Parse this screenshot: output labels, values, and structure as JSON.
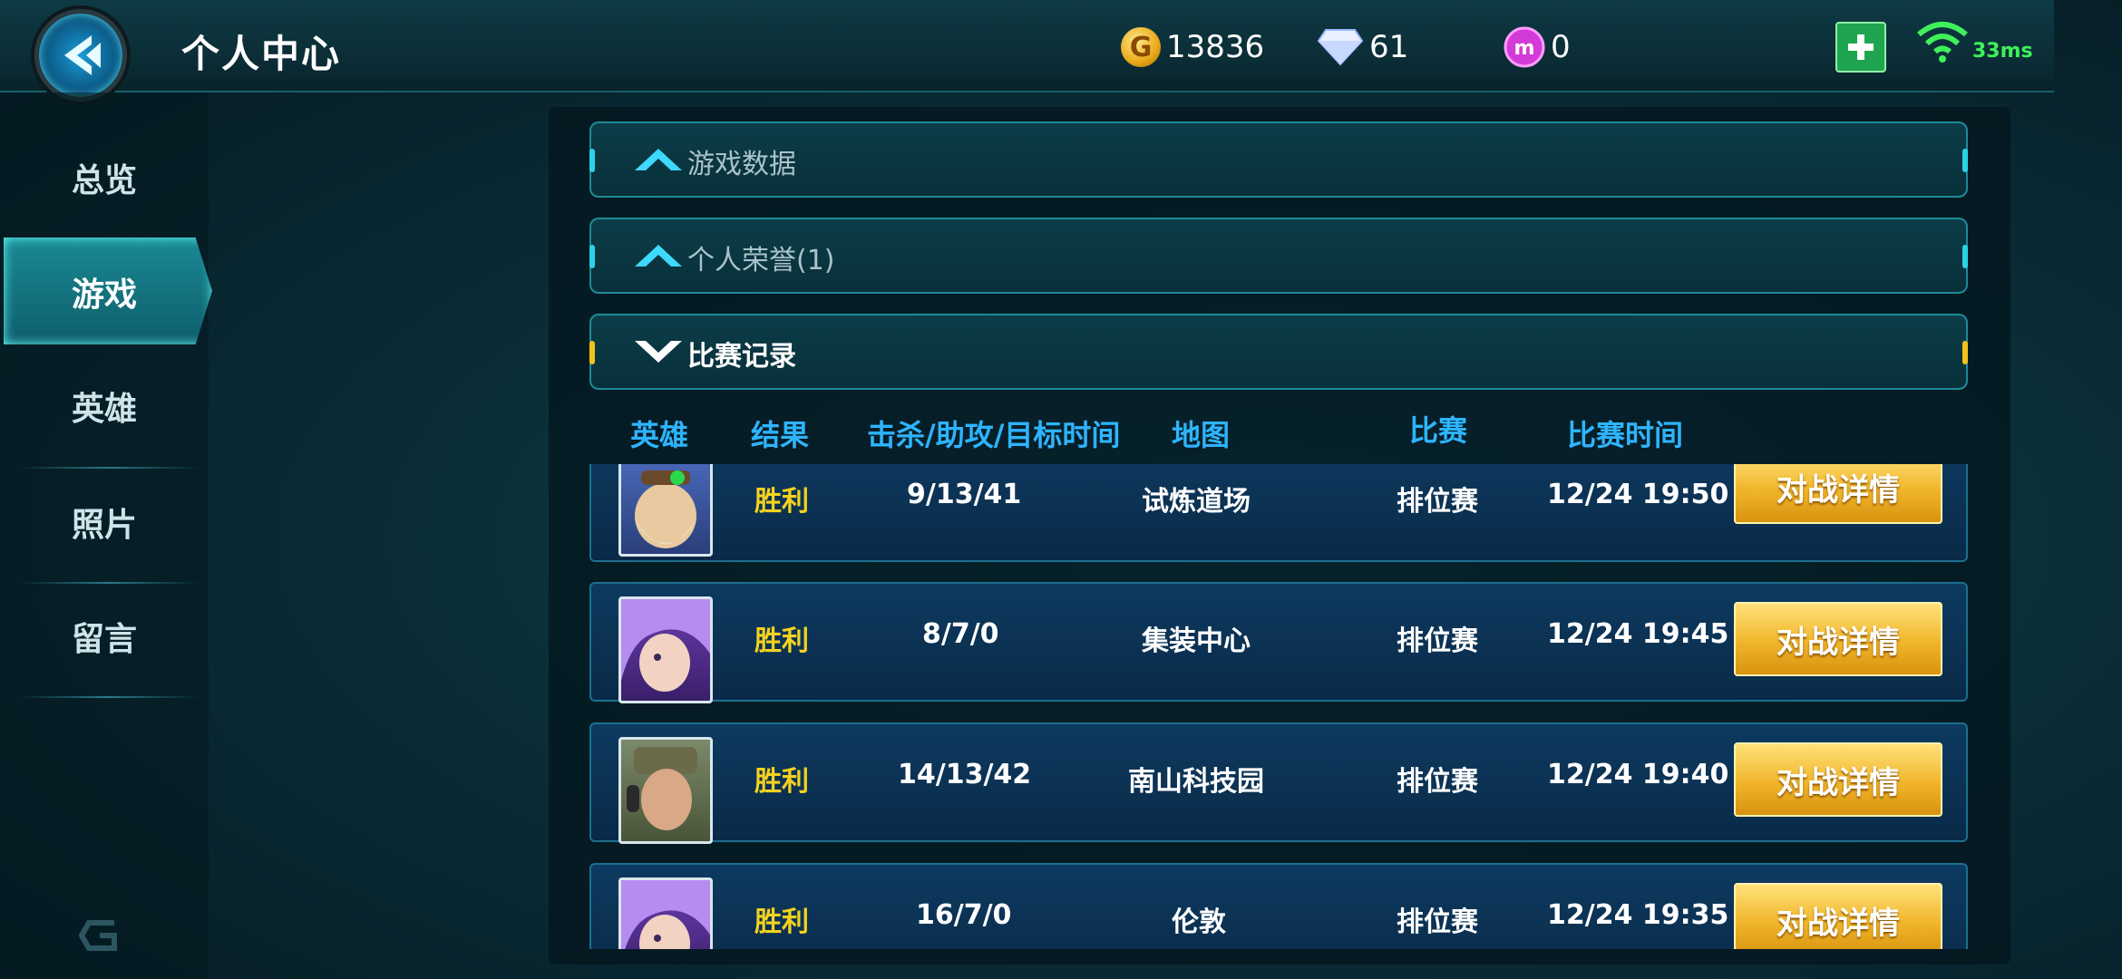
{
  "header": {
    "title": "个人中心",
    "gold": "13836",
    "diamond": "61",
    "gem": "0",
    "coin_glyph": "G",
    "ping": "33ms"
  },
  "sidebar": {
    "items": [
      {
        "label": "总览"
      },
      {
        "label": "游戏",
        "active": true
      },
      {
        "label": "英雄"
      },
      {
        "label": "照片"
      },
      {
        "label": "留言"
      }
    ]
  },
  "sections": [
    {
      "label": "游戏数据",
      "state": "collapsed-up"
    },
    {
      "label": "个人荣誉(1)",
      "state": "collapsed-up"
    },
    {
      "label": "比赛记录",
      "state": "expanded"
    }
  ],
  "table": {
    "columns": [
      "英雄",
      "结果",
      "击杀/助攻/目标时间",
      "地图",
      "比赛",
      "比赛时间"
    ],
    "detail_button": "对战详情",
    "rows": [
      {
        "hero": "hero-avatar-engineer",
        "result": "胜利",
        "kda": "9/13/41",
        "map": "试炼道场",
        "mode": "排位赛",
        "time": "12/24 19:50"
      },
      {
        "hero": "hero-avatar-purple-hair",
        "result": "胜利",
        "kda": "8/7/0",
        "map": "集装中心",
        "mode": "排位赛",
        "time": "12/24 19:45"
      },
      {
        "hero": "hero-avatar-soldier",
        "result": "胜利",
        "kda": "14/13/42",
        "map": "南山科技园",
        "mode": "排位赛",
        "time": "12/24 19:40"
      },
      {
        "hero": "hero-avatar-purple-hair",
        "result": "胜利",
        "kda": "16/7/0",
        "map": "伦敦",
        "mode": "排位赛",
        "time": "12/24 19:35"
      }
    ]
  },
  "colors": {
    "accent": "#2bd3e6",
    "result": "#f3d21e",
    "header_text": "#2eb4ff",
    "button": "#f0b52a"
  }
}
